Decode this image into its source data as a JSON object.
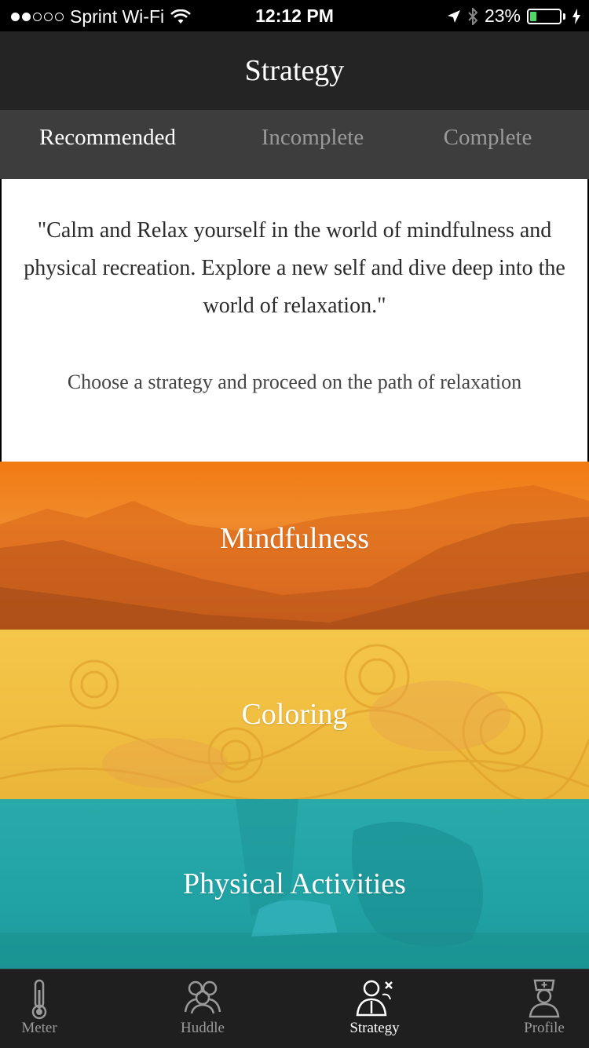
{
  "status": {
    "carrier": "Sprint Wi-Fi",
    "time": "12:12 PM",
    "battery_percent": "23%",
    "battery_level": 0.23,
    "signal_bars": 2
  },
  "nav": {
    "title": "Strategy"
  },
  "tabs": [
    {
      "label": "Recommended",
      "active": true
    },
    {
      "label": "Incomplete",
      "active": false
    },
    {
      "label": "Complete",
      "active": false
    }
  ],
  "intro": {
    "quote": "\"Calm and Relax yourself in the world of mindfulness and physical recreation. Explore a new self and dive deep into the world of relaxation.\"",
    "prompt": "Choose a strategy and proceed on the path of relaxation"
  },
  "strategies": [
    {
      "title": "Mindfulness",
      "color": "#F17A13"
    },
    {
      "title": "Coloring",
      "color": "#F4C64A"
    },
    {
      "title": "Physical Activities",
      "color": "#22A4A6"
    }
  ],
  "tabbar": [
    {
      "label": "Meter",
      "icon": "thermometer-icon",
      "active": false
    },
    {
      "label": "Huddle",
      "icon": "group-icon",
      "active": false
    },
    {
      "label": "Strategy",
      "icon": "strategist-icon",
      "active": true
    },
    {
      "label": "Profile",
      "icon": "nurse-icon",
      "active": false
    }
  ]
}
